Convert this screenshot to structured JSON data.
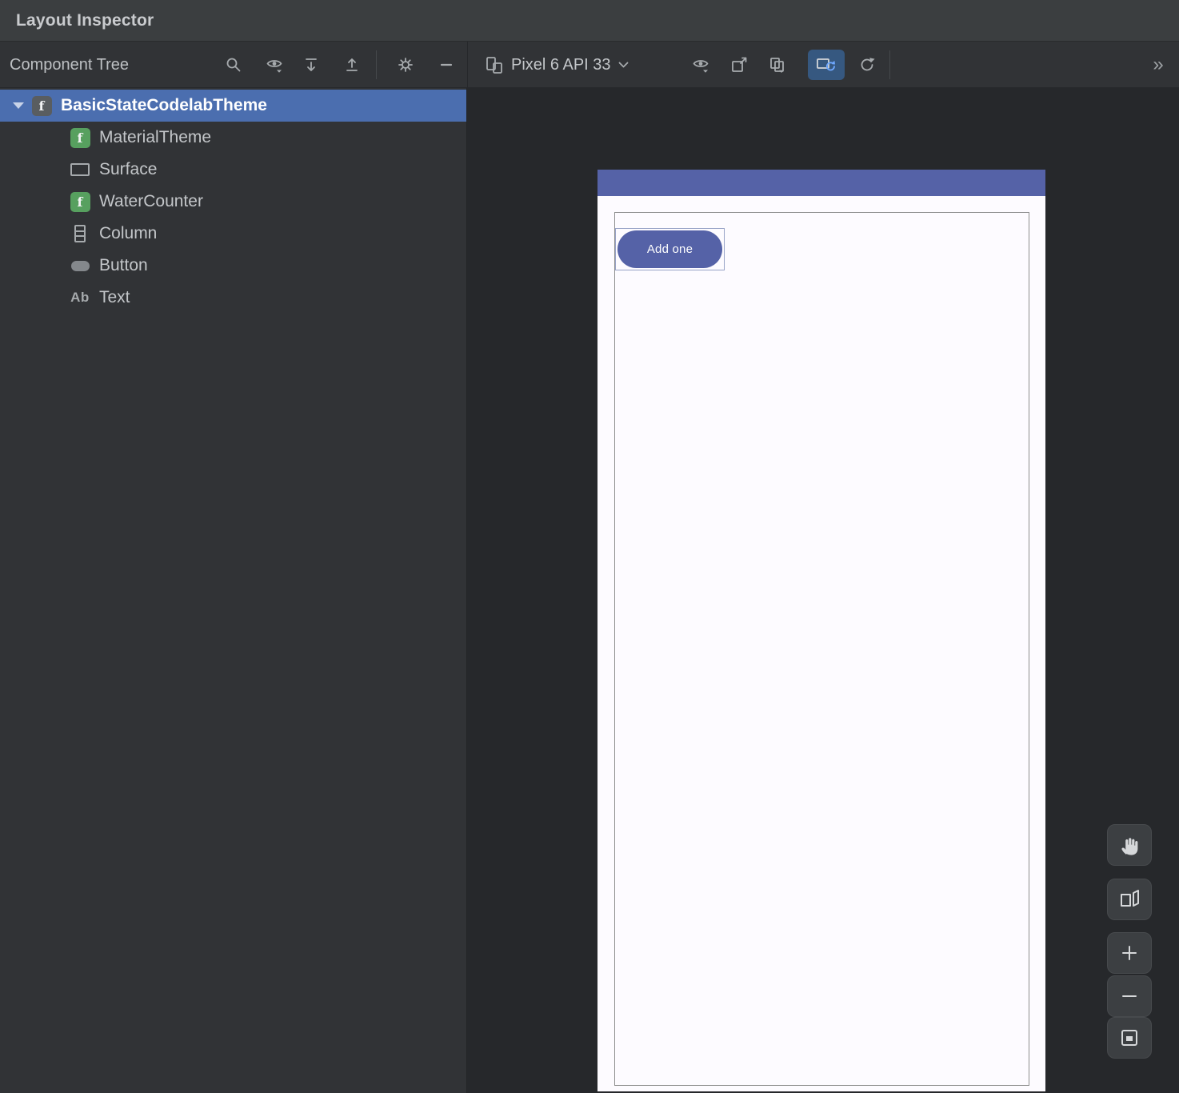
{
  "window": {
    "title": "Layout Inspector"
  },
  "toolbar": {
    "panel_label": "Component Tree",
    "left_icons": [
      "search-icon",
      "visibility-options-icon",
      "expand-all-icon",
      "collapse-all-icon",
      "settings-icon",
      "hide-panel-icon"
    ],
    "device_selector": {
      "icon": "device-icon",
      "label": "Pixel 6 API 33",
      "chevron": "chevron-down-icon"
    },
    "right_icons": [
      "view-options-icon",
      "screenshot-icon",
      "snapshot-layers-icon",
      "live-updates-icon",
      "refresh-icon"
    ],
    "live_updates_active": true,
    "overflow_label": "»"
  },
  "component_tree": {
    "selection_color": "#4b6eaf",
    "items": [
      {
        "label": "BasicStateCodelabTheme",
        "icon": "compose-function-icon",
        "indent": 0,
        "expanded": true,
        "selected": true
      },
      {
        "label": "MaterialTheme",
        "icon": "compose-function-green-icon",
        "indent": 1
      },
      {
        "label": "Surface",
        "icon": "surface-icon",
        "indent": 1
      },
      {
        "label": "WaterCounter",
        "icon": "compose-function-green-icon",
        "indent": 1
      },
      {
        "label": "Column",
        "icon": "column-icon",
        "indent": 1
      },
      {
        "label": "Button",
        "icon": "button-icon",
        "indent": 1
      },
      {
        "label": "Text",
        "icon": "text-icon",
        "indent": 1
      }
    ]
  },
  "device_render": {
    "device_name": "Pixel 6 API 33",
    "button_label": "Add one",
    "colors": {
      "app_bar": "#5562a7",
      "screen": "#fdfbff",
      "button_fill": "#5562a7",
      "button_text": "#ffffff",
      "bounds_highlight": "#97a2c6"
    }
  },
  "zoom_controls": [
    "pan-icon",
    "rotate-3d-icon",
    "zoom-in-icon",
    "zoom-out-icon",
    "zoom-to-fit-icon"
  ]
}
